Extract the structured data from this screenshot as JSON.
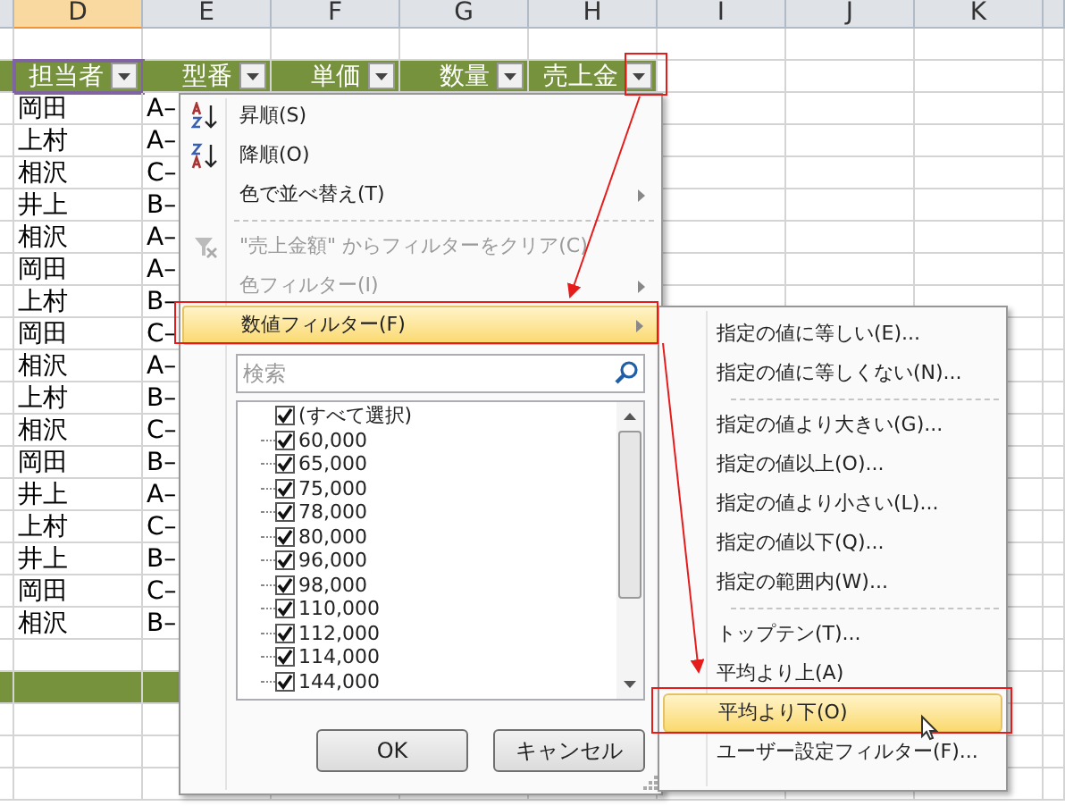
{
  "columns": [
    {
      "label": "D",
      "selected": true
    },
    {
      "label": "E",
      "selected": false
    },
    {
      "label": "F",
      "selected": false
    },
    {
      "label": "G",
      "selected": false
    },
    {
      "label": "H",
      "selected": false
    },
    {
      "label": "I",
      "selected": false
    },
    {
      "label": "J",
      "selected": false
    },
    {
      "label": "K",
      "selected": false
    }
  ],
  "header_row": [
    {
      "label": "担当者",
      "selected": true
    },
    {
      "label": "型番",
      "selected": false
    },
    {
      "label": "単価",
      "selected": false
    },
    {
      "label": "数量",
      "selected": false
    },
    {
      "label": "売上金",
      "selected": false
    }
  ],
  "rows": [
    {
      "person": "岡田",
      "model": "A–"
    },
    {
      "person": "上村",
      "model": "A–"
    },
    {
      "person": "相沢",
      "model": "C–"
    },
    {
      "person": "井上",
      "model": "B–"
    },
    {
      "person": "相沢",
      "model": "A–"
    },
    {
      "person": "岡田",
      "model": "A–"
    },
    {
      "person": "上村",
      "model": "B–"
    },
    {
      "person": "岡田",
      "model": "C–"
    },
    {
      "person": "相沢",
      "model": "A–"
    },
    {
      "person": "上村",
      "model": "B–"
    },
    {
      "person": "相沢",
      "model": "C–"
    },
    {
      "person": "岡田",
      "model": "B–"
    },
    {
      "person": "井上",
      "model": "A–"
    },
    {
      "person": "上村",
      "model": "C–"
    },
    {
      "person": "井上",
      "model": "B–"
    },
    {
      "person": "岡田",
      "model": "C–"
    },
    {
      "person": "相沢",
      "model": "B–"
    }
  ],
  "filter_menu": {
    "items": [
      {
        "kind": "sort_asc",
        "label": "昇順(S)",
        "disabled": false,
        "submenu": false,
        "selected": false
      },
      {
        "kind": "sort_desc",
        "label": "降順(O)",
        "disabled": false,
        "submenu": false,
        "selected": false
      },
      {
        "kind": "item",
        "label": "色で並べ替え(T)",
        "disabled": false,
        "submenu": true,
        "selected": false
      },
      {
        "kind": "separator"
      },
      {
        "kind": "clear",
        "label": "\"売上金額\" からフィルターをクリア(C)",
        "disabled": true,
        "submenu": false,
        "selected": false
      },
      {
        "kind": "item",
        "label": "色フィルター(I)",
        "disabled": true,
        "submenu": true,
        "selected": false
      },
      {
        "kind": "item",
        "label": "数値フィルター(F)",
        "disabled": false,
        "submenu": true,
        "selected": true
      }
    ],
    "search": {
      "placeholder": "検索"
    },
    "values": [
      {
        "label": "(すべて選択)",
        "checked": true
      },
      {
        "label": "60,000",
        "checked": true
      },
      {
        "label": "65,000",
        "checked": true
      },
      {
        "label": "75,000",
        "checked": true
      },
      {
        "label": "78,000",
        "checked": true
      },
      {
        "label": "80,000",
        "checked": true
      },
      {
        "label": "96,000",
        "checked": true
      },
      {
        "label": "98,000",
        "checked": true
      },
      {
        "label": "110,000",
        "checked": true
      },
      {
        "label": "112,000",
        "checked": true
      },
      {
        "label": "114,000",
        "checked": true
      },
      {
        "label": "144,000",
        "checked": true
      }
    ],
    "buttons": [
      "OK",
      "キャンセル"
    ]
  },
  "number_filter_menu": {
    "items": [
      {
        "kind": "item",
        "label": "指定の値に等しい(E)...",
        "selected": false
      },
      {
        "kind": "item",
        "label": "指定の値に等しくない(N)...",
        "selected": false
      },
      {
        "kind": "separator"
      },
      {
        "kind": "item",
        "label": "指定の値より大きい(G)...",
        "selected": false
      },
      {
        "kind": "item",
        "label": "指定の値以上(O)...",
        "selected": false
      },
      {
        "kind": "item",
        "label": "指定の値より小さい(L)...",
        "selected": false
      },
      {
        "kind": "item",
        "label": "指定の値以下(Q)...",
        "selected": false
      },
      {
        "kind": "item",
        "label": "指定の範囲内(W)...",
        "selected": false
      },
      {
        "kind": "separator"
      },
      {
        "kind": "item",
        "label": "トップテン(T)...",
        "selected": false
      },
      {
        "kind": "item",
        "label": "平均より上(A)",
        "selected": false
      },
      {
        "kind": "item",
        "label": "平均より下(O)",
        "selected": true
      },
      {
        "kind": "item",
        "label": "ユーザー設定フィルター(F)...",
        "selected": false
      }
    ]
  }
}
